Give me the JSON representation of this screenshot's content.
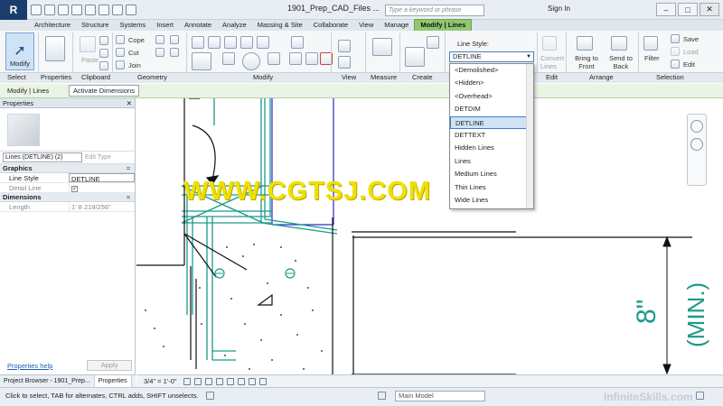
{
  "titlebar": {
    "doc_title": "1901_Prep_CAD_Files ...",
    "search_placeholder": "Type a keyword or phrase",
    "sign_in": "Sign In"
  },
  "tabs": [
    "Architecture",
    "Structure",
    "Systems",
    "Insert",
    "Annotate",
    "Analyze",
    "Massing & Site",
    "Collaborate",
    "View",
    "Manage",
    "Modify | Lines"
  ],
  "active_tab": "Modify | Lines",
  "ribbon": {
    "modify_label": "Modify",
    "paste_label": "Paste",
    "cope_label": "Cope",
    "cut_label": "Cut",
    "join_label": "Join",
    "line_style_label": "Line Style:",
    "line_style_value": "DETLINE",
    "convert_lines_label": "Convert Lines",
    "bring_to_front_label": "Bring to Front",
    "send_to_back_label": "Send to Back",
    "filter_label": "Filter",
    "save_label": "Save",
    "load_label": "Load",
    "edit_label": "Edit",
    "panels": {
      "select": "Select",
      "properties": "Properties",
      "clipboard": "Clipboard",
      "geometry": "Geometry",
      "modify": "Modify",
      "view": "View",
      "measure": "Measure",
      "create": "Create",
      "edit": "Edit",
      "arrange": "Arrange",
      "selection": "Selection"
    }
  },
  "dropdown": {
    "items": [
      "<Demolished>",
      "<Hidden>",
      "<Overhead>",
      "DETDIM",
      "DETLINE",
      "DETTEXT",
      "Hidden Lines",
      "Lines",
      "Medium Lines",
      "Thin Lines",
      "Wide Lines"
    ],
    "selected": "DETLINE"
  },
  "context": {
    "label": "Modify | Lines",
    "activate_dimensions": "Activate Dimensions"
  },
  "properties": {
    "title": "Properties",
    "type_selector": "Lines (DETLINE) (2)",
    "edit_type": "Edit Type",
    "groups": [
      {
        "name": "Graphics",
        "rows": [
          {
            "key": "Line Style",
            "value": "DETLINE"
          },
          {
            "key": "Detail Line",
            "value": "✓"
          }
        ]
      },
      {
        "name": "Dimensions",
        "rows": [
          {
            "key": "Length",
            "value": "1'  8 219/256\""
          }
        ]
      }
    ],
    "help_link": "Properties help",
    "apply": "Apply"
  },
  "browser_tabs": [
    "Project Browser - 1901_Prep...",
    "Properties"
  ],
  "drawing": {
    "watermark": "WWW.CGTSJ.COM",
    "dimension_text": "8\"",
    "min_text": "(MIN.)"
  },
  "viewbar": {
    "scale": "3/4\" = 1'-0\""
  },
  "statusbar": {
    "hint": "Click to select, TAB for alternates, CTRL adds, SHIFT unselects.",
    "model": "Main Model",
    "brand": "InfiniteSkills.com"
  },
  "colors": {
    "accent": "#8fc86f",
    "selection": "#cfe3f7",
    "detail_line": "#1a9a8a",
    "watermark": "#f0e000"
  }
}
